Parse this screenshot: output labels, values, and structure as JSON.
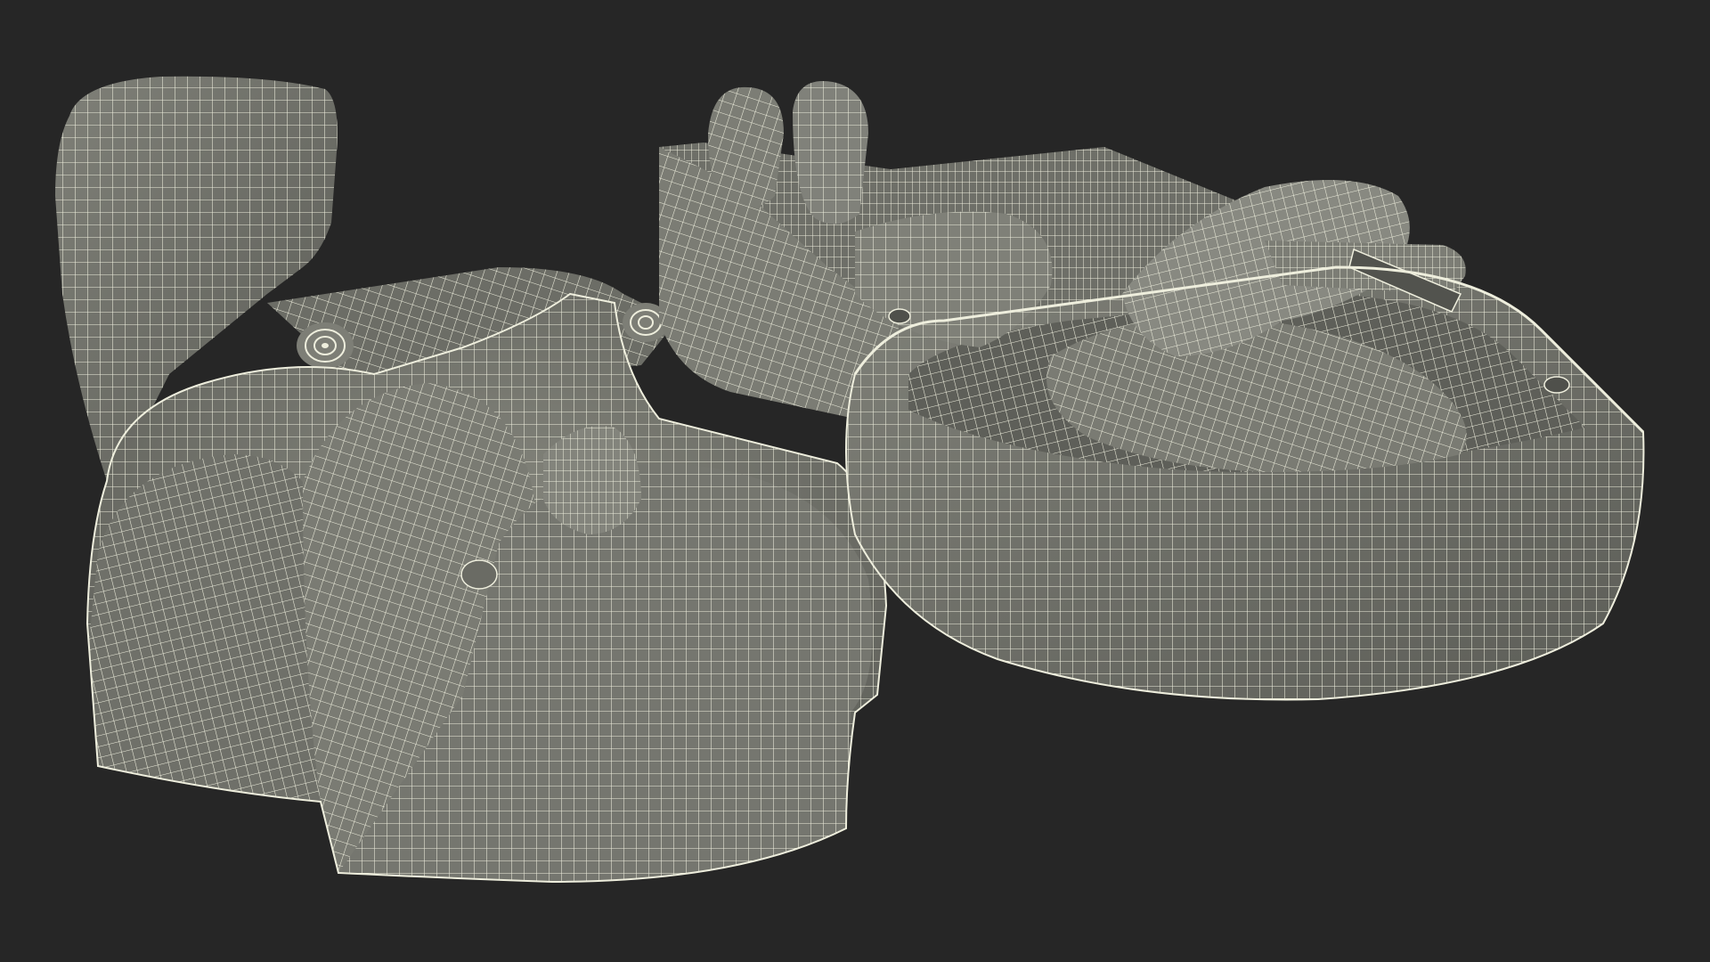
{
  "scene": {
    "render_mode": "wireframe-over-shaded",
    "background_color": "#262626",
    "surface_color": "#77786f",
    "surface_shadow_color": "#5f605a",
    "surface_highlight_color": "#8a8b82",
    "wire_color": "#eeeedd",
    "objects": [
      "left-model-half",
      "right-model-half"
    ]
  }
}
